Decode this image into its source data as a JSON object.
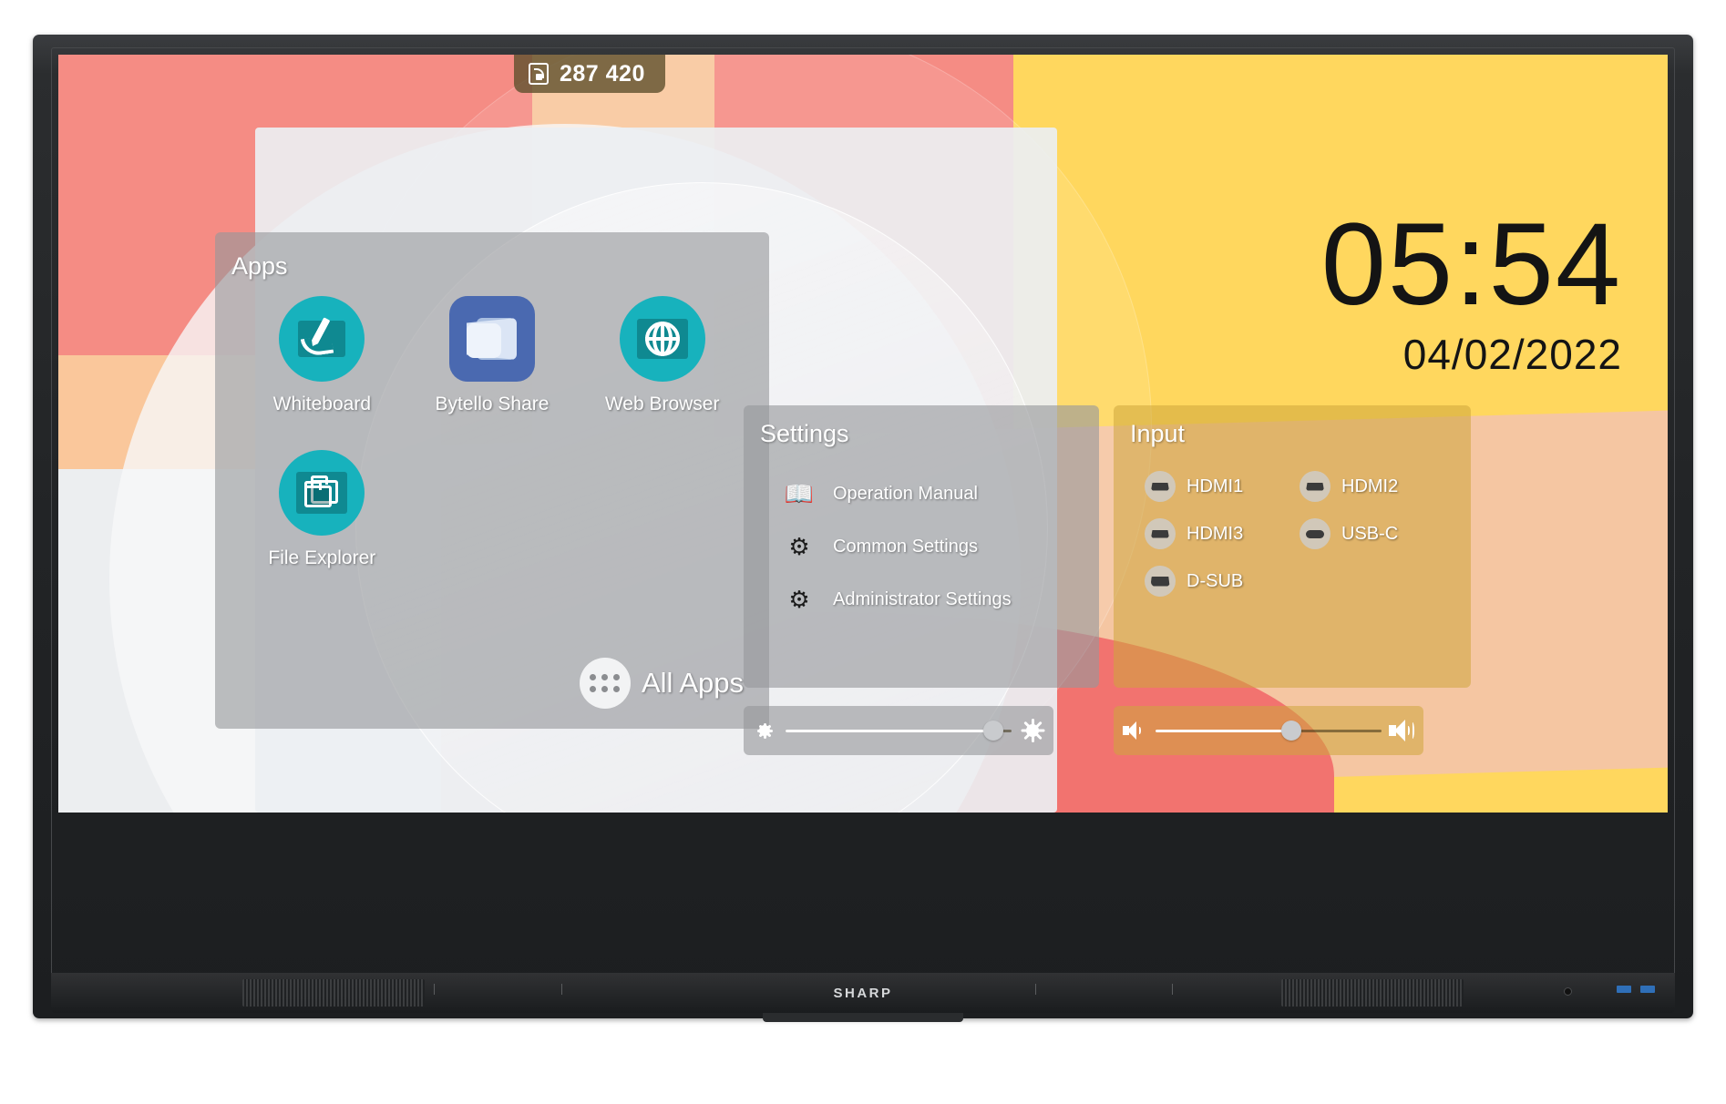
{
  "device": {
    "brand": "SHARP"
  },
  "share_code": {
    "icon": "cast-icon",
    "value": "287 420"
  },
  "clock": {
    "time": "05:54",
    "date": "04/02/2022"
  },
  "apps_panel": {
    "title": "Apps",
    "items": [
      {
        "label": "Whiteboard",
        "icon": "whiteboard-icon",
        "style": "round"
      },
      {
        "label": "Bytello Share",
        "icon": "bytello-share-icon",
        "style": "square"
      },
      {
        "label": "Web Browser",
        "icon": "web-browser-icon",
        "style": "round"
      },
      {
        "label": "File Explorer",
        "icon": "file-explorer-icon",
        "style": "round"
      }
    ],
    "all_apps_label": "All Apps"
  },
  "settings_panel": {
    "title": "Settings",
    "items": [
      {
        "label": "Operation Manual",
        "icon": "book-icon"
      },
      {
        "label": "Common Settings",
        "icon": "gear-icon"
      },
      {
        "label": "Administrator Settings",
        "icon": "gear-people-icon"
      }
    ]
  },
  "input_panel": {
    "title": "Input",
    "items": [
      {
        "label": "HDMI1",
        "icon": "hdmi-port-icon"
      },
      {
        "label": "HDMI2",
        "icon": "hdmi-port-icon"
      },
      {
        "label": "HDMI3",
        "icon": "hdmi-port-icon"
      },
      {
        "label": "USB-C",
        "icon": "usbc-port-icon"
      },
      {
        "label": "D-SUB",
        "icon": "dsub-port-icon"
      }
    ]
  },
  "brightness_slider": {
    "name": "brightness",
    "low_icon": "brightness-low-icon",
    "high_icon": "brightness-high-icon",
    "value": 92
  },
  "volume_slider": {
    "name": "volume",
    "low_icon": "volume-low-icon",
    "high_icon": "volume-high-icon",
    "value": 60
  },
  "colors": {
    "accent_teal": "#17b2bd",
    "accent_blue": "#4a69b0",
    "wallpaper_red": "#f58c84",
    "wallpaper_yellow": "#ffd75e",
    "wallpaper_peach": "#f5c6a2",
    "panel_gray": "rgba(150,152,155,.62)",
    "panel_gold": "rgba(205,165,60,.55)",
    "share_pill": "rgba(95,80,45,.80)"
  }
}
